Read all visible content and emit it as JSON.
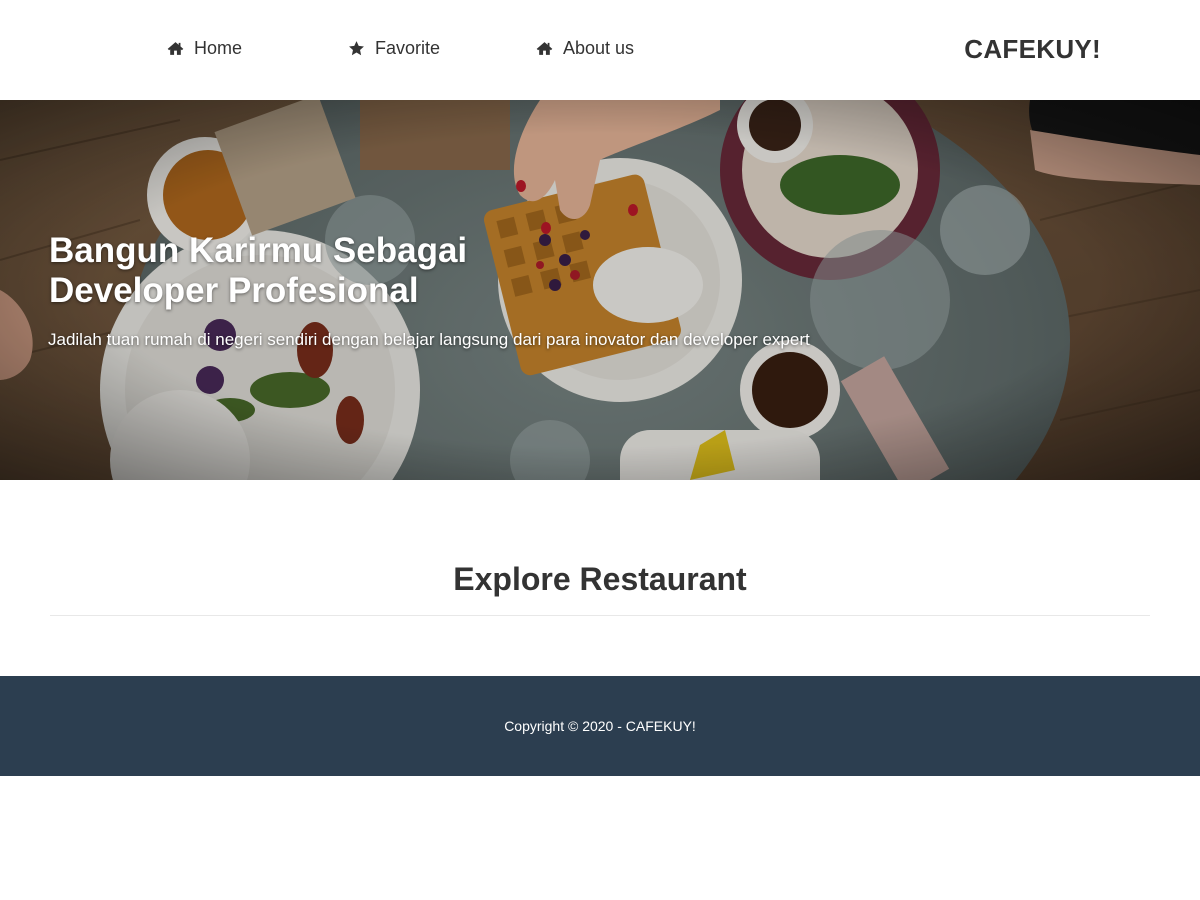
{
  "nav": {
    "items": [
      {
        "label": "Home",
        "icon": "home-icon"
      },
      {
        "label": "Favorite",
        "icon": "star-icon"
      },
      {
        "label": "About us",
        "icon": "home-icon"
      }
    ],
    "brand": "CAFEKUY!"
  },
  "hero": {
    "title": "Bangun Karirmu Sebagai Developer Profesional",
    "subtitle": "Jadilah tuan rumah di negeri sendiri dengan belajar langsung dari para inovator dan developer expert"
  },
  "explore": {
    "title": "Explore Restaurant"
  },
  "footer": {
    "copyright": "Copyright © 2020 - CAFEKUY!"
  },
  "colors": {
    "footer_bg": "#2c3e50",
    "text": "#333333"
  }
}
